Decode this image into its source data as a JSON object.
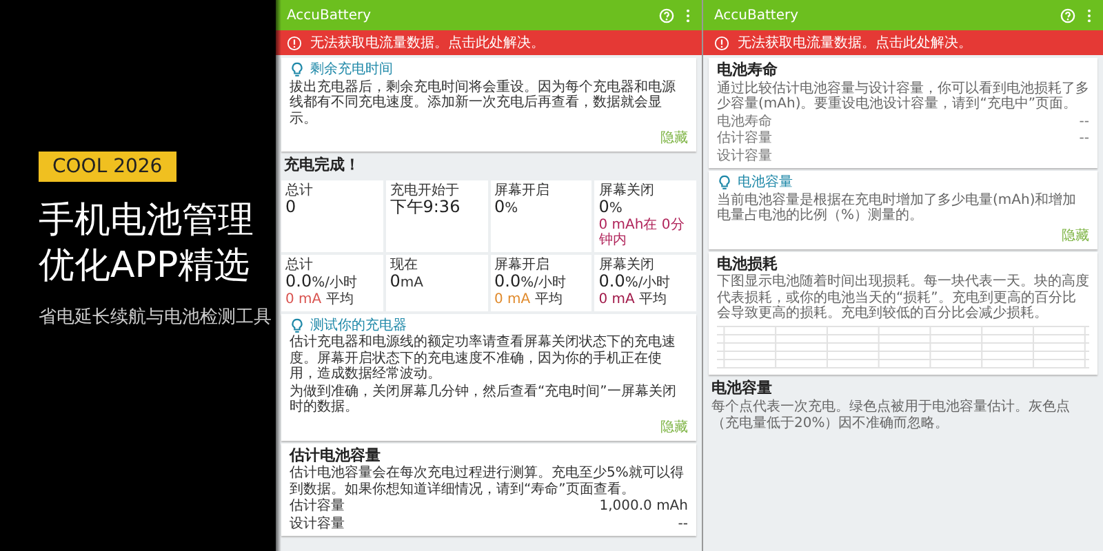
{
  "banner": {
    "tag": "COOL 2026",
    "title": "手机电池管理优化APP精选",
    "subtitle": "省电延长续航与电池检测工具"
  },
  "screens": [
    {
      "app_title": "AccuBattery",
      "alert": "无法获取电流量数据。点击此处解决。",
      "sections": [
        {
          "kind": "tip",
          "title": "剩余充电时间",
          "paragraphs": [
            "拔出充电器后，剩余充电时间将会重设。因为每个充电器和电源线都有不同充电速度。添加新一次充电后再查看，数据就会显示。"
          ],
          "action": "隐藏"
        },
        {
          "kind": "heading",
          "title": "充电完成！"
        },
        {
          "kind": "stats",
          "cells": [
            {
              "label": "总计",
              "value": "0"
            },
            {
              "label": "充电开始于",
              "value": "下午9:36"
            },
            {
              "label": "屏幕开启",
              "value": "0",
              "unit": "%"
            },
            {
              "label": "屏幕关闭",
              "value": "0",
              "unit": "%",
              "note": {
                "value": "0 mAh在 0分钟内",
                "color": "#b0245a"
              }
            }
          ]
        },
        {
          "kind": "stats",
          "cells": [
            {
              "label": "总计",
              "value": "0.0",
              "unit": "%/小时",
              "note": {
                "value": "0 mA",
                "label": "平均",
                "color": "#d9534f"
              }
            },
            {
              "label": "现在",
              "value": "0",
              "unit": "mA"
            },
            {
              "label": "屏幕开启",
              "value": "0.0",
              "unit": "%/小时",
              "note": {
                "value": "0 mA",
                "label": "平均",
                "color": "#e08a2c"
              }
            },
            {
              "label": "屏幕关闭",
              "value": "0.0",
              "unit": "%/小时",
              "note": {
                "value": "0 mA",
                "label": "平均",
                "color": "#a01848"
              }
            }
          ]
        },
        {
          "kind": "tip",
          "title": "测试你的充电器",
          "paragraphs": [
            "估计充电器和电源线的额定功率请查看屏幕关闭状态下的充电速度。屏幕开启状态下的充电速度不准确，因为你的手机正在使用，造成数据经常波动。",
            "为做到准确，关闭屏幕几分钟，然后查看“充电时间”一屏幕关闭时的数据。"
          ],
          "action": "隐藏"
        },
        {
          "kind": "card",
          "title": "估计电池容量",
          "description": "估计电池容量会在每次充电过程进行测算。充电至少5%就可以得到数据。如果你想知道详细情况，请到“寿命”页面查看。",
          "rows": [
            {
              "label": "估计容量",
              "value": "1,000.0 mAh"
            },
            {
              "label": "设计容量",
              "value": "--"
            }
          ]
        }
      ]
    },
    {
      "app_title": "AccuBattery",
      "alert": "无法获取电流量数据。点击此处解决。",
      "sections": [
        {
          "kind": "card",
          "title": "电池寿命",
          "description": "通过比较估计电池容量与设计容量，你可以看到电池损耗了多少容量(mAh)。要重设电池设计容量，请到“充电中”页面。",
          "rows": [
            {
              "label": "电池寿命",
              "value": "--"
            },
            {
              "label": "估计容量",
              "value": "--"
            },
            {
              "label": "设计容量"
            }
          ]
        },
        {
          "kind": "tip",
          "title": "电池容量",
          "paragraphs": [
            "当前电池容量是根据在充电时增加了多少电量(mAh)和增加电量占电池的比例（%）测量的。"
          ],
          "action": "隐藏"
        },
        {
          "kind": "chart",
          "title": "电池损耗",
          "description": "下图显示电池随着时间出现损耗。每一块代表一天。块的高度代表损耗，或你的电池当天的“损耗”。充电到更高的百分比会导致更高的损耗。充电到较低的百分比会减少损耗。"
        },
        {
          "kind": "heading_desc",
          "title": "电池容量",
          "description": "每个点代表一次充电。绿色点被用于电池容量估计。灰色点（充电量低于20%）因不准确而忽略。"
        }
      ]
    }
  ]
}
